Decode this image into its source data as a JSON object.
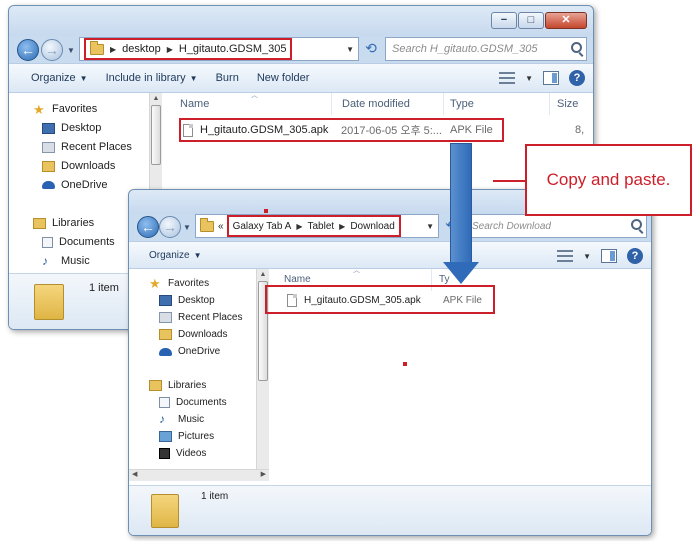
{
  "window1": {
    "caption_buttons": [
      "−",
      "□",
      "✕"
    ],
    "breadcrumb": [
      "desktop",
      "H_gitauto.GDSM_305"
    ],
    "search_placeholder": "Search H_gitauto.GDSM_305",
    "toolbar": {
      "organize": "Organize",
      "include_in_library": "Include in library",
      "burn": "Burn",
      "new_folder": "New folder"
    },
    "nav": {
      "favorites": "Favorites",
      "desktop": "Desktop",
      "recent_places": "Recent Places",
      "downloads": "Downloads",
      "onedrive": "OneDrive",
      "libraries": "Libraries",
      "documents": "Documents",
      "music": "Music"
    },
    "columns": {
      "name": "Name",
      "date_modified": "Date modified",
      "type": "Type",
      "size": "Size"
    },
    "file": {
      "name": "H_gitauto.GDSM_305.apk",
      "date": "2017-06-05 오후 5:...",
      "type": "APK File",
      "size": "8,"
    },
    "status": "1 item"
  },
  "window2": {
    "breadcrumb_prefix": "«",
    "breadcrumb": [
      "Galaxy Tab A",
      "Tablet",
      "Download"
    ],
    "search_placeholder": "Search Download",
    "toolbar": {
      "organize": "Organize"
    },
    "nav": {
      "favorites": "Favorites",
      "desktop": "Desktop",
      "recent_places": "Recent Places",
      "downloads": "Downloads",
      "onedrive": "OneDrive",
      "libraries": "Libraries",
      "documents": "Documents",
      "music": "Music",
      "pictures": "Pictures",
      "videos": "Videos"
    },
    "columns": {
      "name": "Name",
      "type": "Ty"
    },
    "file": {
      "name": "H_gitauto.GDSM_305.apk",
      "type": "APK File"
    },
    "status": "1 item"
  },
  "callout": {
    "text": "Copy and paste."
  },
  "colors": {
    "highlight_red": "#cc1f2a",
    "arrow_blue": "#2f6bb8",
    "window_frame": "#c9dbee"
  }
}
